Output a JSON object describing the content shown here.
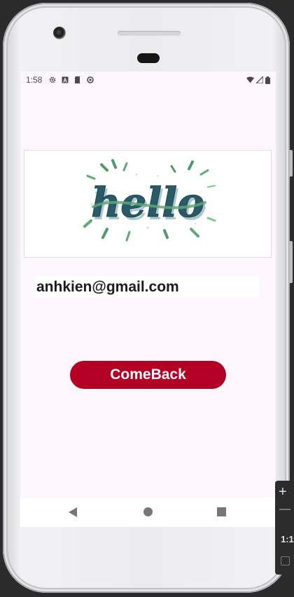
{
  "status_bar": {
    "time": "1:58",
    "left_icons": [
      "gear-icon",
      "font-icon",
      "sd-card-icon",
      "sync-icon"
    ],
    "right_icons": [
      "wifi-icon",
      "signal-icon",
      "battery-icon"
    ]
  },
  "hello_image": {
    "text": "hello",
    "colors": {
      "ink": "#2a5a68",
      "ribbon": "#5fa776",
      "splash": "#7cc98a"
    }
  },
  "email": {
    "value": "anhkien@gmail.com"
  },
  "comeback_button": {
    "label": "ComeBack",
    "color": "#b30024"
  },
  "nav_bar": {
    "buttons": [
      "back-icon",
      "home-icon",
      "recents-icon"
    ]
  },
  "emulator_toolbar": {
    "zoom_in": "+",
    "zoom_out": "−",
    "ratio": "1:1"
  },
  "colors": {
    "screen_bg": "#fdf7fd",
    "accent": "#b30024"
  }
}
